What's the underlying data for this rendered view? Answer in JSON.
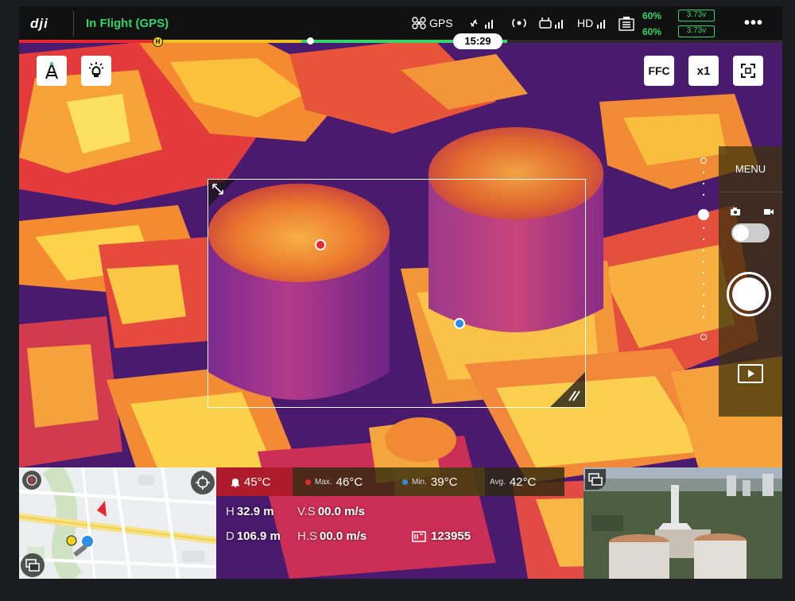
{
  "topbar": {
    "logo": "dji",
    "flight_status": "In Flight (GPS)",
    "gps_label": "GPS",
    "hd_label": "HD",
    "battery": [
      {
        "percent": "60%",
        "voltage": "3.73v"
      },
      {
        "percent": "60%",
        "voltage": "3.73v"
      }
    ],
    "more": "•••"
  },
  "progress": {
    "time": "15:29",
    "home_marker": "H",
    "red_fraction": 0.18,
    "yellow_fraction": 0.37,
    "green_fraction": 0.64
  },
  "toolbar_left": {
    "tower_icon": "antenna-tower-icon",
    "light_icon": "beacon-light-icon"
  },
  "toolbar_right": {
    "ffc_label": "FFC",
    "zoom_label": "x1",
    "switch_icon": "view-switch-icon"
  },
  "camera_panel": {
    "menu_label": "MENU",
    "photo_icon": "camera-icon",
    "video_icon": "video-icon",
    "shutter_icon": "shutter-button",
    "playback_icon": "playback-icon"
  },
  "temperatures": {
    "alarm": "45°C",
    "max_tag": "Max.",
    "max": "46°C",
    "min_tag": "Min.",
    "min": "39°C",
    "avg_tag": "Avg.",
    "avg": "42°C"
  },
  "telemetry": {
    "height_label": "H",
    "height": "32.9 m",
    "vs_label": "V.S",
    "vs": "00.0 m/s",
    "distance_label": "D",
    "distance": "106.9 m",
    "hs_label": "H.S",
    "hs": "00.0 m/s",
    "storage": "123955"
  },
  "colors": {
    "status_green": "#35d46a",
    "alert_red": "#e8262e",
    "min_blue": "#2b8fe8",
    "home_yellow": "#f3d21a"
  }
}
